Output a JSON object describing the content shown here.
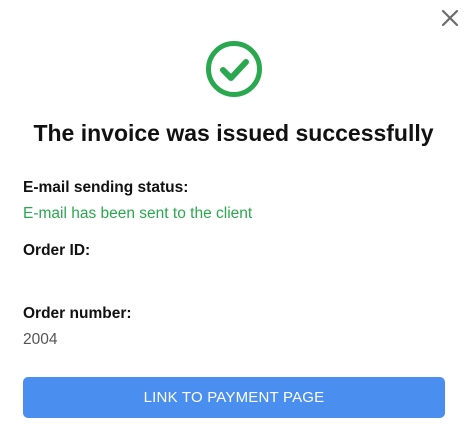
{
  "dialog": {
    "title": "The invoice was issued successfully",
    "close_icon": "close-icon",
    "status_icon": "check-circle-icon"
  },
  "fields": {
    "email_status_label": "E-mail sending status:",
    "email_status_value": "E-mail has been sent to the client",
    "order_id_label": "Order ID:",
    "order_id_value": "",
    "order_number_label": "Order number:",
    "order_number_value": "2004"
  },
  "actions": {
    "payment_link_label": "LINK TO PAYMENT PAGE"
  },
  "colors": {
    "success": "#2aa84f",
    "primary_button": "#4a8ff0",
    "close_icon": "#6b6b6b"
  }
}
